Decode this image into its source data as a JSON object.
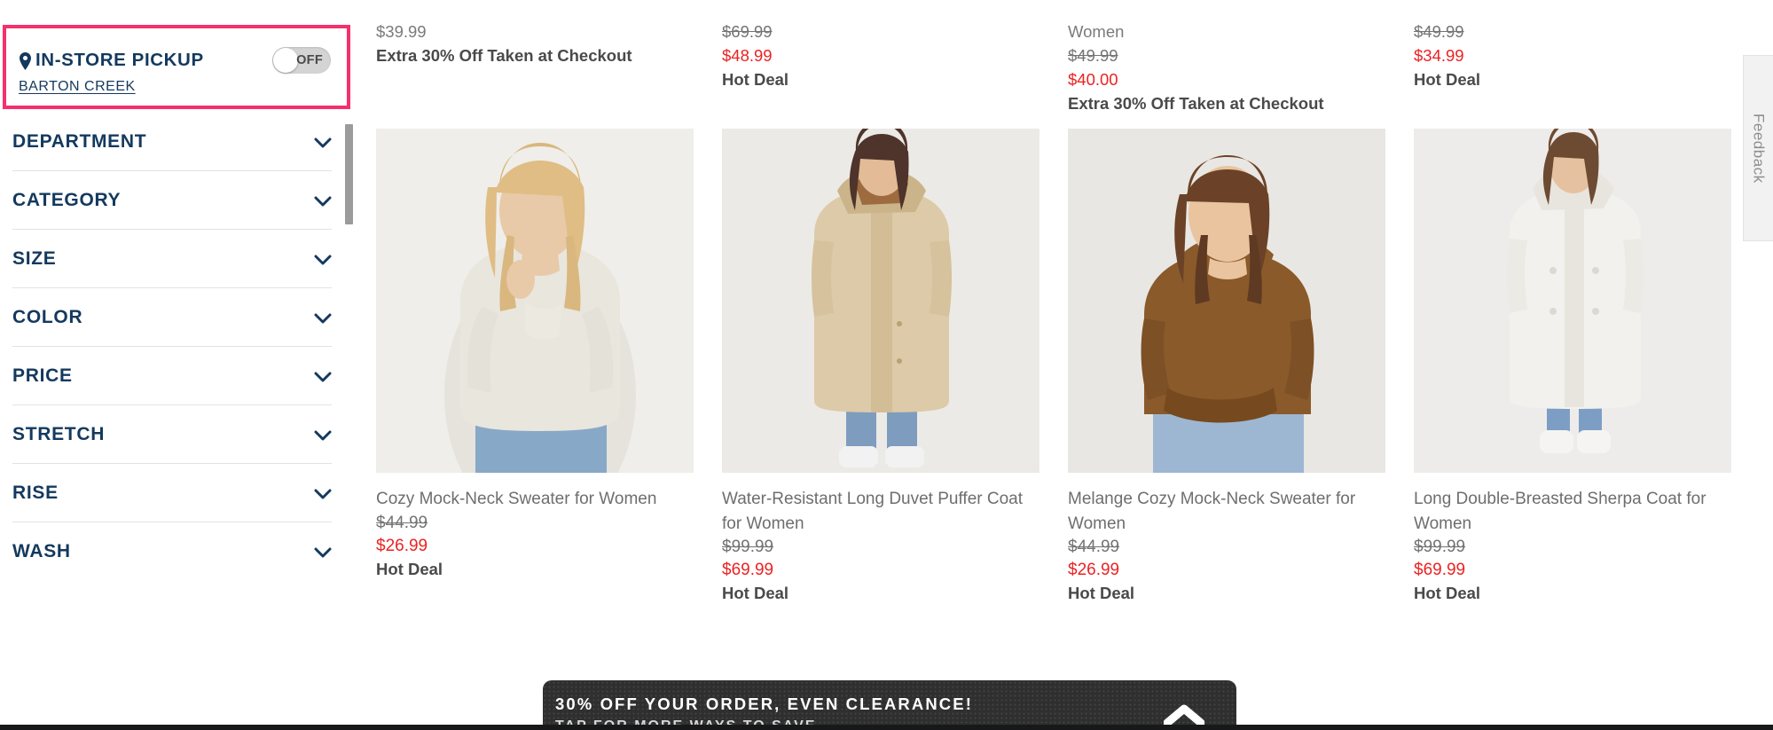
{
  "sidebar": {
    "pickup": {
      "title": "IN-STORE PICKUP",
      "toggle_state": "OFF",
      "store_name": "BARTON CREEK",
      "border_color": "#f4316d",
      "title_color": "#14395e"
    },
    "filters": [
      {
        "label": "DEPARTMENT"
      },
      {
        "label": "CATEGORY"
      },
      {
        "label": "SIZE"
      },
      {
        "label": "COLOR"
      },
      {
        "label": "PRICE"
      },
      {
        "label": "STRETCH"
      },
      {
        "label": "RISE"
      },
      {
        "label": "WASH"
      }
    ]
  },
  "grid": {
    "previous_row": [
      {
        "lines": [
          {
            "text": "$39.99",
            "style": "gray"
          },
          {
            "text": "Extra 30% Off Taken at Checkout",
            "style": "bold"
          }
        ]
      },
      {
        "lines": [
          {
            "text": "$69.99",
            "style": "strike"
          },
          {
            "text": "$48.99",
            "style": "red"
          },
          {
            "text": "Hot Deal",
            "style": "bold"
          }
        ]
      },
      {
        "lines": [
          {
            "text": "Women",
            "style": "gray"
          },
          {
            "text": "$49.99",
            "style": "strike"
          },
          {
            "text": "$40.00",
            "style": "red"
          },
          {
            "text": "Extra 30% Off Taken at Checkout",
            "style": "bold"
          }
        ]
      },
      {
        "lines": [
          {
            "text": "$49.99",
            "style": "strike"
          },
          {
            "text": "$34.99",
            "style": "red"
          },
          {
            "text": "Hot Deal",
            "style": "bold"
          }
        ]
      }
    ],
    "products": [
      {
        "name": "Cozy Mock-Neck Sweater for Women",
        "price_old": "$44.99",
        "price_new": "$26.99",
        "badge": "Hot Deal",
        "image_alt": "woman-in-cream-mock-neck-sweater"
      },
      {
        "name": "Water-Resistant Long Duvet Puffer Coat for Women",
        "price_old": "$99.99",
        "price_new": "$69.99",
        "badge": "Hot Deal",
        "image_alt": "woman-in-beige-long-puffer-coat"
      },
      {
        "name": "Melange Cozy Mock-Neck Sweater for Women",
        "price_old": "$44.99",
        "price_new": "$26.99",
        "badge": "Hot Deal",
        "image_alt": "woman-in-brown-melange-sweater"
      },
      {
        "name": "Long Double-Breasted Sherpa Coat for Women",
        "price_old": "$99.99",
        "price_new": "$69.99",
        "badge": "Hot Deal",
        "image_alt": "woman-in-white-sherpa-coat"
      }
    ]
  },
  "feedback": {
    "label": "Feedback"
  },
  "promo": {
    "line1": "30% OFF YOUR ORDER, EVEN CLEARANCE!",
    "line2": "TAP FOR MORE WAYS TO SAVE",
    "background": "#2f2f2f"
  },
  "colors": {
    "accent_pink": "#f4316d",
    "navy": "#14395e",
    "sale_red": "#ec2222",
    "muted_gray": "#6e6e6e"
  }
}
